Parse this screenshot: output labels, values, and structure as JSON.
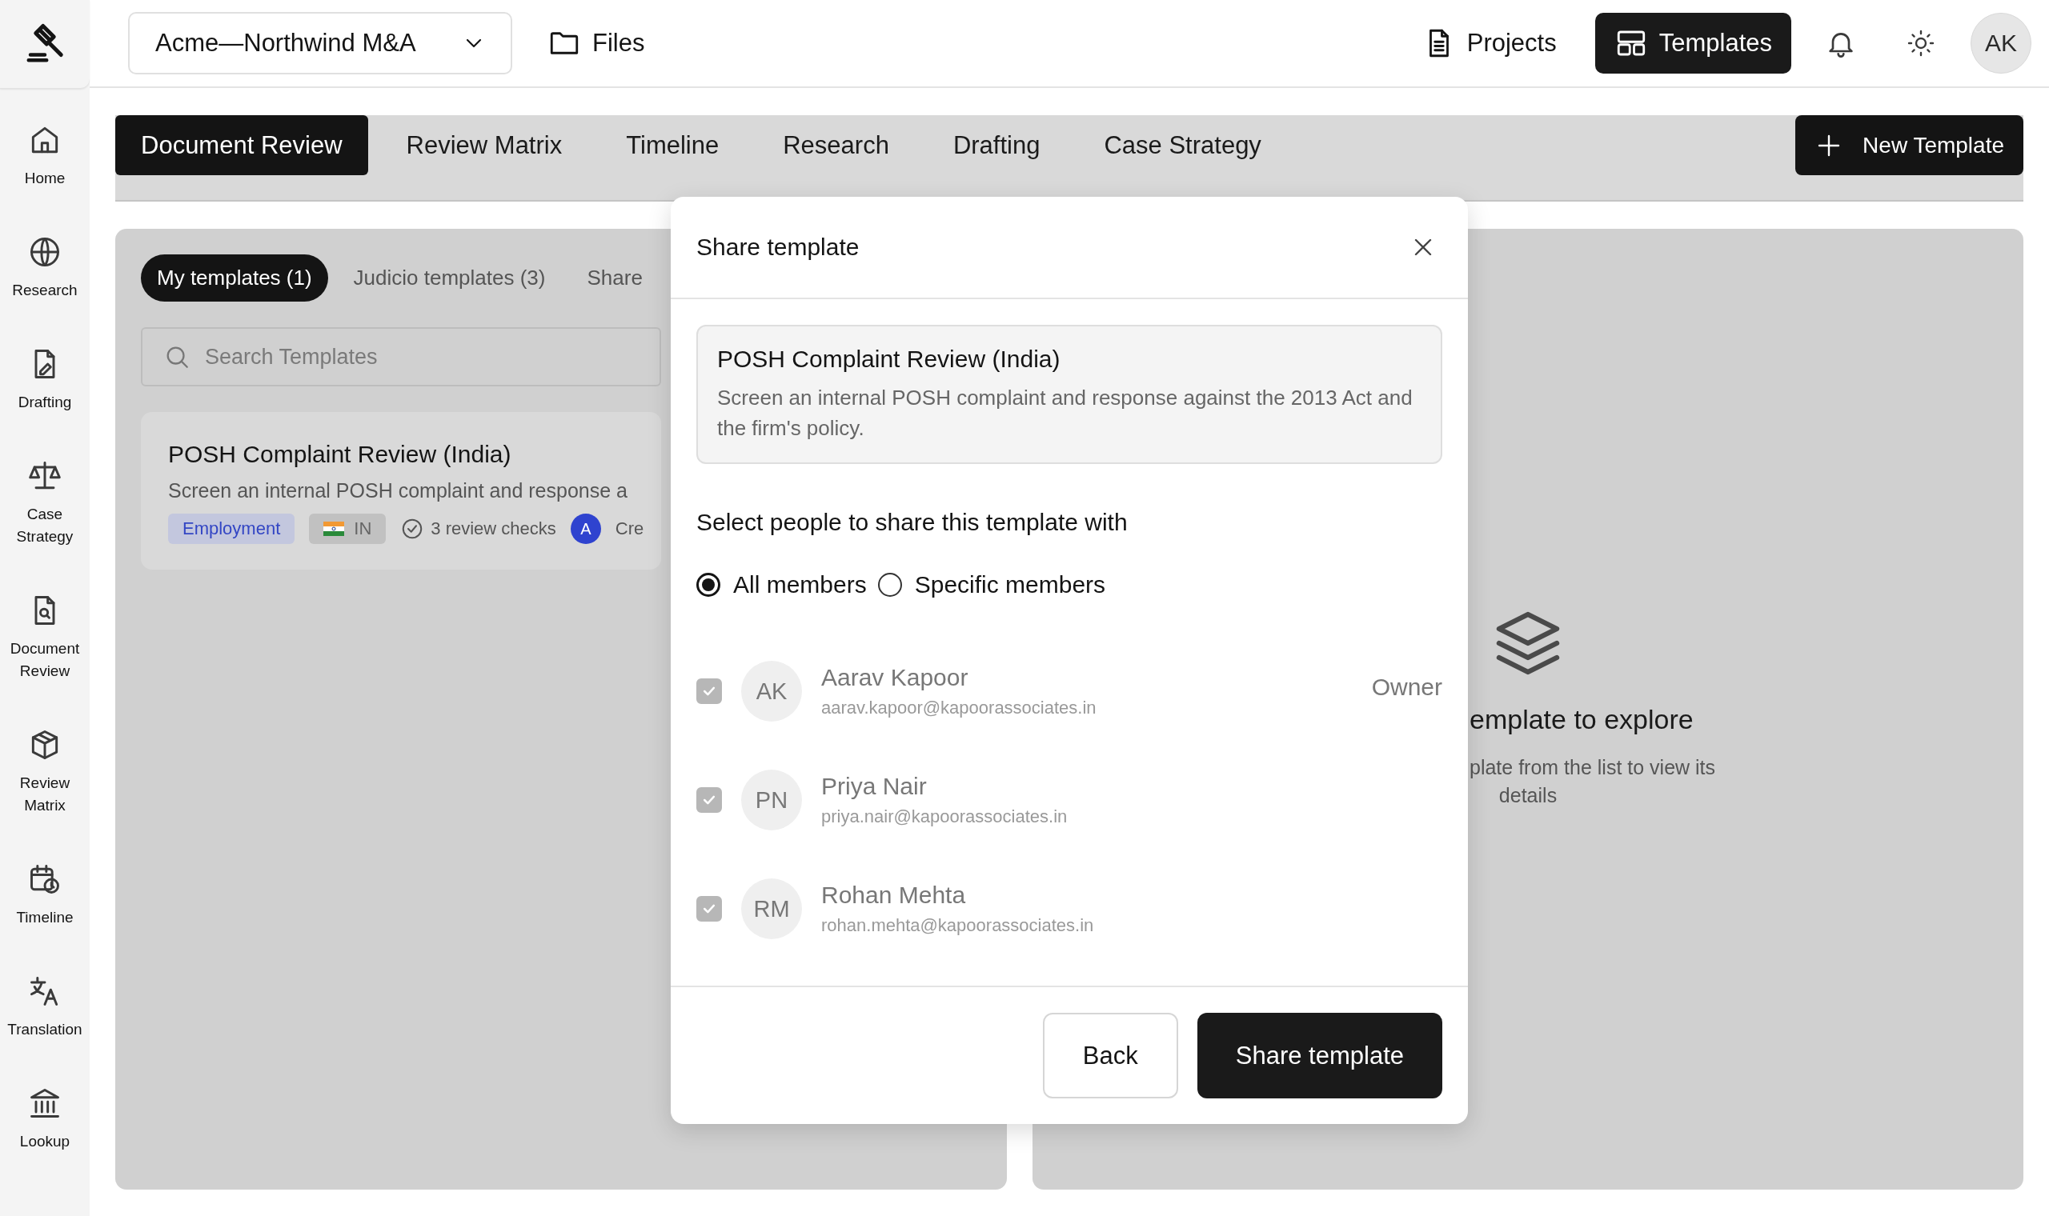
{
  "project_selector": {
    "value": "Acme—Northwind M&A"
  },
  "files_link": {
    "label": "Files"
  },
  "nav": [
    {
      "label": "Projects",
      "selected": false
    },
    {
      "label": "Templates",
      "selected": true
    }
  ],
  "user": {
    "initials": "AK"
  },
  "sidebar": {
    "items": [
      {
        "label": "Home"
      },
      {
        "label": "Research"
      },
      {
        "label": "Drafting"
      },
      {
        "label": "Case Strategy"
      },
      {
        "label": "Document Review"
      },
      {
        "label": "Review Matrix"
      },
      {
        "label": "Timeline"
      },
      {
        "label": "Translation"
      },
      {
        "label": "Lookup"
      }
    ]
  },
  "tabs": [
    {
      "label": "Document Review",
      "selected": true
    },
    {
      "label": "Review Matrix",
      "selected": false
    },
    {
      "label": "Timeline",
      "selected": false
    },
    {
      "label": "Research",
      "selected": false
    },
    {
      "label": "Drafting",
      "selected": false
    },
    {
      "label": "Case Strategy",
      "selected": false
    }
  ],
  "new_template_button": {
    "label": "New Template"
  },
  "template_filters": [
    {
      "label": "My templates (1)",
      "selected": true
    },
    {
      "label": "Judicio templates (3)",
      "selected": false
    },
    {
      "label": "Share",
      "selected": false
    }
  ],
  "search": {
    "placeholder": "Search Templates"
  },
  "template_cards": [
    {
      "title": "POSH Complaint Review (India)",
      "description": "Screen an internal POSH complaint and response a",
      "tags": [
        {
          "kind": "category",
          "label": "Employment"
        },
        {
          "kind": "jurisdiction",
          "label": "IN"
        }
      ],
      "checks": "3 review checks",
      "creator_initial": "A",
      "creator_text": "Cre"
    }
  ],
  "empty_state": {
    "title": "emplate to explore",
    "lines": [
      "plate from the list to view its",
      "details"
    ]
  },
  "dialog": {
    "title": "Share template",
    "template": {
      "title": "POSH Complaint Review (India)",
      "description": "Screen an internal POSH complaint and response against the 2013 Act and the firm's policy."
    },
    "prompt": "Select people to share this template with",
    "audience_options": [
      {
        "label": "All members",
        "selected": true
      },
      {
        "label": "Specific members",
        "selected": false
      }
    ],
    "members": [
      {
        "initials": "AK",
        "name": "Aarav Kapoor",
        "email": "aarav.kapoor@kapoorassociates.in",
        "role": "Owner",
        "checked": true,
        "disabled": true
      },
      {
        "initials": "PN",
        "name": "Priya Nair",
        "email": "priya.nair@kapoorassociates.in",
        "checked": true,
        "disabled": true
      },
      {
        "initials": "RM",
        "name": "Rohan Mehta",
        "email": "rohan.mehta@kapoorassociates.in",
        "checked": true,
        "disabled": true
      }
    ],
    "buttons": [
      {
        "label": "Back",
        "kind": "secondary"
      },
      {
        "label": "Share template",
        "kind": "primary"
      }
    ]
  }
}
